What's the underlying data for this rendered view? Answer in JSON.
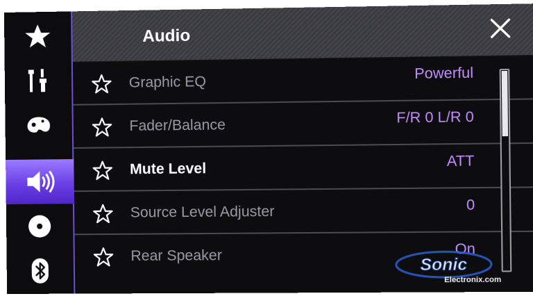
{
  "header": {
    "title": "Audio"
  },
  "sidebar": {
    "items": [
      {
        "icon": "star-icon",
        "active": false
      },
      {
        "icon": "settings-tools-icon",
        "active": false
      },
      {
        "icon": "theme-palette-icon",
        "active": false
      },
      {
        "icon": "speaker-icon",
        "active": true
      },
      {
        "icon": "disc-icon",
        "active": false
      },
      {
        "icon": "bluetooth-icon",
        "active": false
      }
    ]
  },
  "list": {
    "items": [
      {
        "label": "Graphic EQ",
        "value": "Powerful"
      },
      {
        "label": "Fader/Balance",
        "value": "F/R 0 L/R 0"
      },
      {
        "label": "Mute Level",
        "value": "ATT",
        "selected": true
      },
      {
        "label": "Source Level Adjuster",
        "value": "0"
      },
      {
        "label": "Rear Speaker",
        "value": "On"
      }
    ]
  },
  "watermark": {
    "brand": "Sonic",
    "sub": "Electronix.com"
  },
  "colors": {
    "accent": "#6a3fe6",
    "value_text": "#c38dff",
    "label_text": "#9a9aa6"
  }
}
